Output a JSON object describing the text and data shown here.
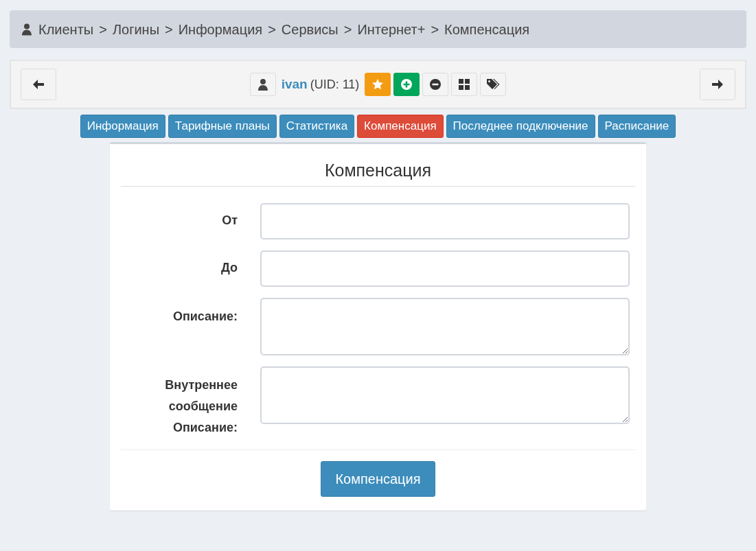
{
  "breadcrumb": {
    "items": [
      "Клиенты",
      "Логины",
      "Информация",
      "Сервисы",
      "Интернет+",
      "Компенсация"
    ],
    "separator": ">"
  },
  "toolbar": {
    "user": "ivan",
    "uid": "(UID: 11)",
    "actions": [
      {
        "kind": "star",
        "color": "#f39c12"
      },
      {
        "kind": "plus",
        "color": "#00a65a"
      },
      {
        "kind": "minus"
      },
      {
        "kind": "grid"
      },
      {
        "kind": "tags"
      }
    ]
  },
  "tabs": [
    {
      "label": "Информация",
      "selected": false
    },
    {
      "label": "Тарифные планы",
      "selected": false
    },
    {
      "label": "Статистика",
      "selected": false
    },
    {
      "label": "Компенсация",
      "selected": true
    },
    {
      "label": "Последнее подключение",
      "selected": false
    },
    {
      "label": "Расписание",
      "selected": false
    }
  ],
  "form": {
    "title": "Компенсация",
    "fields": [
      {
        "label": "От",
        "kind": "input"
      },
      {
        "label": "До",
        "kind": "input"
      },
      {
        "label": "Описание:",
        "kind": "textarea"
      },
      {
        "label": "Внутреннее сообщение Описание:",
        "kind": "textarea"
      }
    ],
    "submit": "Компенсация"
  }
}
